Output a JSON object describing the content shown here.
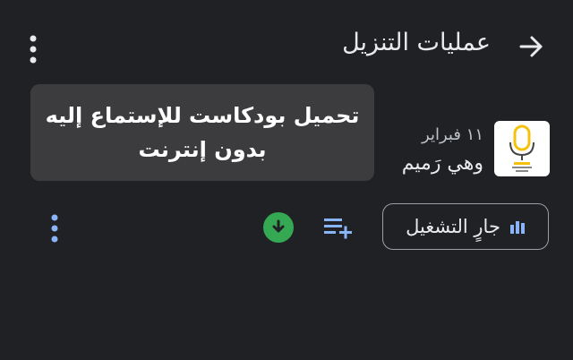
{
  "header": {
    "title": "عمليات التنزيل",
    "back_icon": "arrow-right-icon",
    "more_icon": "more-vert-icon"
  },
  "tooltip": {
    "line1": "تحميل بودكاست للإستماع إليه",
    "line2": "بدون إنترنت"
  },
  "episode": {
    "date": "١١ فبراير",
    "title": "وهي رَميم",
    "thumbnail_icon": "microphone-logo"
  },
  "actions": {
    "playing_label": "جارٍ التشغيل",
    "playing_icon": "equalizer-bars-icon",
    "queue_icon": "playlist-add-icon",
    "download_icon": "download-done-icon",
    "more_icon": "more-vert-icon"
  },
  "colors": {
    "background": "#202124",
    "accent_blue": "#8ab4f8",
    "download_green": "#34a853",
    "mic_yellow": "#f4c20d"
  }
}
